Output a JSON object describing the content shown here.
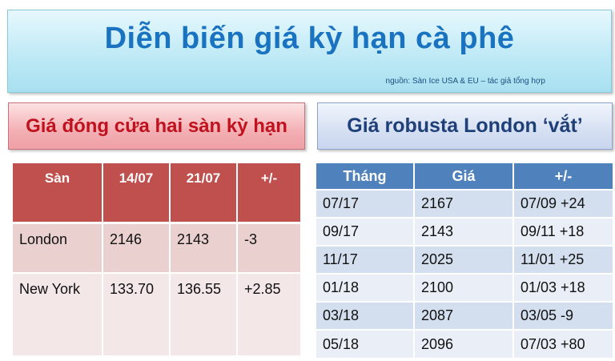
{
  "title": "Diễn biến giá kỳ hạn cà phê",
  "source": "nguồn: Sàn Ice  USA & EU – tác giả tổng hợp",
  "left_panel": {
    "heading": "Giá đóng cửa hai sàn kỳ hạn",
    "columns": [
      "Sàn",
      "14/07",
      "21/07",
      "+/-"
    ],
    "rows": [
      [
        "London",
        "2146",
        "2143",
        "-3"
      ],
      [
        "New York",
        "133.70",
        "136.55",
        "+2.85"
      ]
    ]
  },
  "right_panel": {
    "heading": "Giá robusta London ‘vắt’",
    "columns": [
      "Tháng",
      "Giá",
      "+/-"
    ],
    "rows": [
      [
        "07/17",
        "2167",
        "07/09 +24"
      ],
      [
        "09/17",
        "2143",
        "09/11 +18"
      ],
      [
        "11/17",
        "2025",
        "11/01 +25"
      ],
      [
        "01/18",
        "2100",
        "01/03 +18"
      ],
      [
        "03/18",
        "2087",
        "03/05 -9"
      ],
      [
        "05/18",
        "2096",
        "07/03 +80"
      ]
    ]
  },
  "colors": {
    "title_text": "#1a73c1",
    "left_heading_text": "#c0121e",
    "right_heading_text": "#1f3f78",
    "left_header_bg": "#c0504d",
    "right_header_bg": "#4f81bd"
  }
}
